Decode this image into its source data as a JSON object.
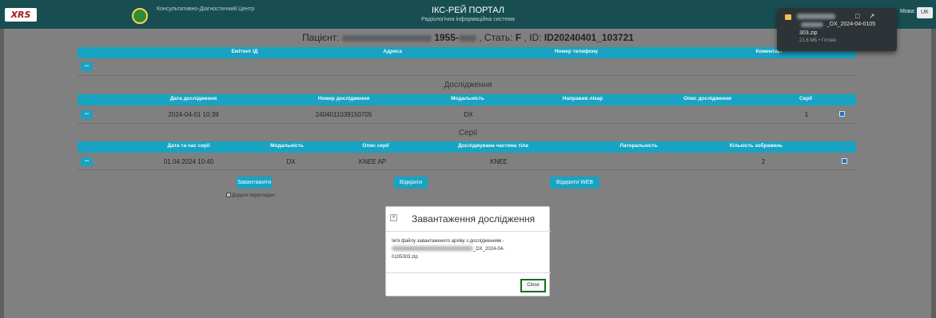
{
  "header": {
    "logo_text": "XRS",
    "centre_name": "Консультативно-Діагностичний Центр",
    "portal_title": "ІКС-РЕЙ ПОРТАЛ",
    "portal_subtitle": "Радіологічна інформаційна система",
    "language_label": "Мова:",
    "language_value": "UK"
  },
  "download_popup": {
    "file_name_line1": "_DX_2024-04-0105",
    "file_name_line2": "303.zip",
    "status": "21,6 МБ • Готово",
    "icons": [
      "file-icon",
      "folder-icon",
      "open-external-icon"
    ]
  },
  "patient": {
    "label": "Пацієнт:",
    "birth_year_prefix": "1955-",
    "sex_label": ", Стать:",
    "sex_value": "F",
    "id_label": ", ID:",
    "id_value": "ID20240401_103721"
  },
  "patient_table": {
    "headers": [
      "Емітент ІД",
      "Адреса",
      "Номер телефону",
      "Коментарі"
    ],
    "more_label": "•••"
  },
  "studies": {
    "title": "Дослідження",
    "headers": [
      "Дата дослідження",
      "Номер дослідження",
      "Модальність",
      "Направив лікар",
      "Опис дослідження",
      "Серії"
    ],
    "rows": [
      {
        "date": "2024-04-01 10:39",
        "number": "2404011039150705",
        "modality": "DX",
        "doctor": "",
        "description": "",
        "series": "1",
        "checked": true
      }
    ],
    "more_label": "•••"
  },
  "series": {
    "title": "Серії",
    "headers": [
      "Дата та час серії",
      "Модальність",
      "Опис серії",
      "Досліджувана частина тіла",
      "Латеральність",
      "Кількість зображень"
    ],
    "rows": [
      {
        "datetime": "01.04.2024 10:40",
        "modality": "DX",
        "description": "KNEE AP",
        "body_part": "KNEE",
        "laterality": "",
        "images": "2",
        "checked": true
      }
    ],
    "more_label": "•••"
  },
  "actions": {
    "download": "Завантажити",
    "add_viewer": "Додати переглядач",
    "open": "Відкрити",
    "open_web": "Відкрити WEB"
  },
  "modal": {
    "title": "Завантаження дослідження",
    "body_prefix": "Ім'я файлу завантаженого архіву з дослідженням -",
    "file_suffix": "_DX_2024-04-",
    "file_suffix2": "0105303.zip",
    "close_label": "Close",
    "close_x": "×"
  },
  "colors": {
    "header_bg": "#184e52",
    "accent": "#19a3c2",
    "overlay_bg": "#808080",
    "close_border": "#11701e"
  }
}
